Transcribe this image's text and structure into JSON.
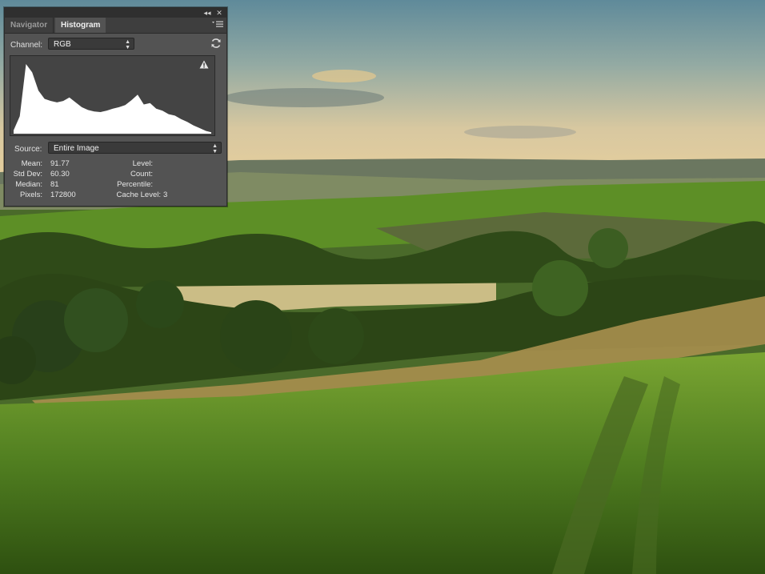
{
  "panel": {
    "tabs": [
      {
        "label": "Navigator",
        "active": false
      },
      {
        "label": "Histogram",
        "active": true
      }
    ],
    "topbar": {
      "collapse_icon": "double-chevron-left-icon",
      "close_icon": "close-icon"
    },
    "menu_icon": "panel-menu-icon",
    "channel": {
      "label": "Channel:",
      "value": "RGB"
    },
    "refresh_icon": "refresh-icon",
    "warning_icon": "warning-icon",
    "source": {
      "label": "Source:",
      "value": "Entire Image"
    },
    "stats_left": [
      {
        "label": "Mean:",
        "value": "91.77"
      },
      {
        "label": "Std Dev:",
        "value": "60.30"
      },
      {
        "label": "Median:",
        "value": "81"
      },
      {
        "label": "Pixels:",
        "value": "172800"
      }
    ],
    "stats_right": [
      {
        "label": "Level:",
        "value": ""
      },
      {
        "label": "Count:",
        "value": ""
      },
      {
        "label": "Percentile:",
        "value": ""
      },
      {
        "label": "Cache Level:",
        "value": "3"
      }
    ]
  },
  "colors": {
    "panel_bg": "#535353",
    "tab_bar": "#3e3e3e",
    "histogram_fill": "#ffffff",
    "histogram_bg": "#444444"
  },
  "chart_data": {
    "type": "area",
    "x": [
      0,
      8,
      16,
      24,
      32,
      40,
      48,
      56,
      64,
      72,
      80,
      88,
      96,
      104,
      112,
      120,
      128,
      136,
      144,
      152,
      160,
      168,
      176,
      184,
      192,
      200,
      208,
      216,
      224,
      232,
      240,
      248,
      255
    ],
    "values": [
      0.05,
      0.25,
      1.0,
      0.88,
      0.62,
      0.5,
      0.47,
      0.45,
      0.47,
      0.52,
      0.45,
      0.38,
      0.34,
      0.32,
      0.31,
      0.33,
      0.36,
      0.38,
      0.41,
      0.48,
      0.56,
      0.42,
      0.44,
      0.36,
      0.33,
      0.28,
      0.26,
      0.21,
      0.17,
      0.12,
      0.08,
      0.04,
      0.02
    ],
    "xlim": [
      0,
      255
    ],
    "ylim": [
      0,
      1
    ]
  }
}
